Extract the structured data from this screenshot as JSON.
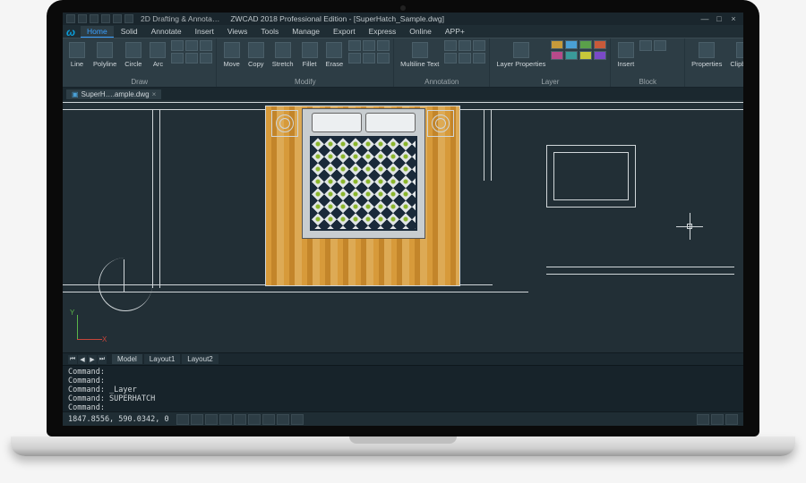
{
  "title": {
    "workspace": "2D Drafting & Annota…",
    "app": "ZWCAD 2018 Professional Edition - [SuperHatch_Sample.dwg]"
  },
  "menu": {
    "tabs": [
      "Home",
      "Solid",
      "Annotate",
      "Insert",
      "Views",
      "Tools",
      "Manage",
      "Export",
      "Express",
      "Online",
      "APP+"
    ],
    "active": 0
  },
  "ribbon": {
    "groups": [
      {
        "label": "Draw",
        "big": [
          {
            "name": "line",
            "label": "Line"
          },
          {
            "name": "polyline",
            "label": "Polyline"
          },
          {
            "name": "circle",
            "label": "Circle"
          },
          {
            "name": "arc",
            "label": "Arc"
          }
        ],
        "small": 6
      },
      {
        "label": "Modify",
        "big": [
          {
            "name": "move",
            "label": "Move"
          },
          {
            "name": "copy",
            "label": "Copy"
          },
          {
            "name": "stretch",
            "label": "Stretch"
          },
          {
            "name": "fillet",
            "label": "Fillet"
          },
          {
            "name": "erase",
            "label": "Erase"
          }
        ],
        "small": 6
      },
      {
        "label": "Annotation",
        "big": [
          {
            "name": "multiline-text",
            "label": "Multiline\nText"
          }
        ],
        "small": 6
      },
      {
        "label": "Layer",
        "big": [
          {
            "name": "layer-properties",
            "label": "Layer\nProperties"
          }
        ],
        "swatches": 8
      },
      {
        "label": "Block",
        "big": [
          {
            "name": "insert",
            "label": "Insert"
          }
        ],
        "small": 2
      },
      {
        "label": "",
        "big": [
          {
            "name": "properties",
            "label": "Properties"
          },
          {
            "name": "clipboard",
            "label": "Clipboard"
          }
        ]
      }
    ]
  },
  "docTab": {
    "label": "SuperH….ample.dwg"
  },
  "canvas": {
    "ucs": {
      "x": "X",
      "y": "Y"
    }
  },
  "layoutTabs": {
    "tabs": [
      "Model",
      "Layout1",
      "Layout2"
    ],
    "active": 0
  },
  "command": {
    "history": [
      "Command:",
      "Command:",
      "Command: _Layer",
      "Command: SUPERHATCH"
    ],
    "prompt": "Command:",
    "value": ""
  },
  "status": {
    "coords": "1847.8556, 590.0342, 0"
  }
}
